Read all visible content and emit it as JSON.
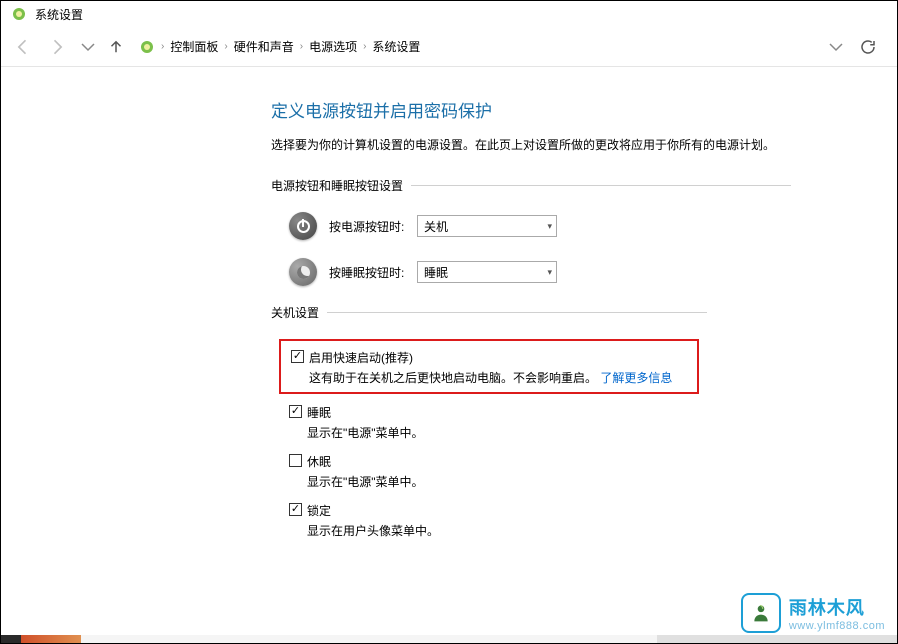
{
  "titlebar": {
    "title": "系统设置"
  },
  "breadcrumb": {
    "items": [
      "控制面板",
      "硬件和声音",
      "电源选项",
      "系统设置"
    ],
    "sep": "›"
  },
  "heading": "定义电源按钮并启用密码保护",
  "subtext": "选择要为你的计算机设置的电源设置。在此页上对设置所做的更改将应用于你所有的电源计划。",
  "section1": {
    "header": "电源按钮和睡眠按钮设置",
    "rows": [
      {
        "label": "按电源按钮时:",
        "value": "关机"
      },
      {
        "label": "按睡眠按钮时:",
        "value": "睡眠"
      }
    ]
  },
  "section2": {
    "header": "关机设置",
    "items": [
      {
        "label": "启用快速启动(推荐)",
        "desc": "这有助于在关机之后更快地启动电脑。不会影响重启。",
        "link": "了解更多信息",
        "checked": true,
        "highlighted": true
      },
      {
        "label": "睡眠",
        "desc": "显示在\"电源\"菜单中。",
        "checked": true
      },
      {
        "label": "休眠",
        "desc": "显示在\"电源\"菜单中。",
        "checked": false
      },
      {
        "label": "锁定",
        "desc": "显示在用户头像菜单中。",
        "checked": true
      }
    ]
  },
  "watermark": {
    "cn": "雨林木风",
    "en": "www.ylmf888.com"
  }
}
